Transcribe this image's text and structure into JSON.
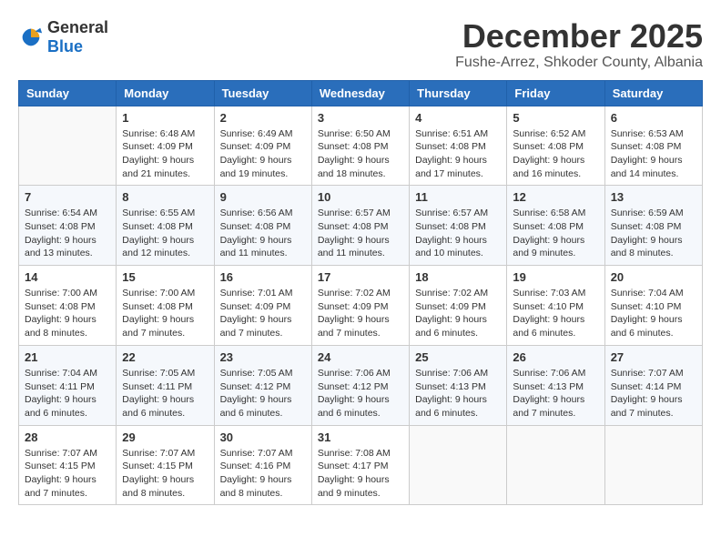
{
  "logo": {
    "general": "General",
    "blue": "Blue"
  },
  "title": {
    "month": "December 2025",
    "location": "Fushe-Arrez, Shkoder County, Albania"
  },
  "headers": [
    "Sunday",
    "Monday",
    "Tuesday",
    "Wednesday",
    "Thursday",
    "Friday",
    "Saturday"
  ],
  "weeks": [
    [
      {
        "day": "",
        "info": ""
      },
      {
        "day": "1",
        "info": "Sunrise: 6:48 AM\nSunset: 4:09 PM\nDaylight: 9 hours\nand 21 minutes."
      },
      {
        "day": "2",
        "info": "Sunrise: 6:49 AM\nSunset: 4:09 PM\nDaylight: 9 hours\nand 19 minutes."
      },
      {
        "day": "3",
        "info": "Sunrise: 6:50 AM\nSunset: 4:08 PM\nDaylight: 9 hours\nand 18 minutes."
      },
      {
        "day": "4",
        "info": "Sunrise: 6:51 AM\nSunset: 4:08 PM\nDaylight: 9 hours\nand 17 minutes."
      },
      {
        "day": "5",
        "info": "Sunrise: 6:52 AM\nSunset: 4:08 PM\nDaylight: 9 hours\nand 16 minutes."
      },
      {
        "day": "6",
        "info": "Sunrise: 6:53 AM\nSunset: 4:08 PM\nDaylight: 9 hours\nand 14 minutes."
      }
    ],
    [
      {
        "day": "7",
        "info": "Sunrise: 6:54 AM\nSunset: 4:08 PM\nDaylight: 9 hours\nand 13 minutes."
      },
      {
        "day": "8",
        "info": "Sunrise: 6:55 AM\nSunset: 4:08 PM\nDaylight: 9 hours\nand 12 minutes."
      },
      {
        "day": "9",
        "info": "Sunrise: 6:56 AM\nSunset: 4:08 PM\nDaylight: 9 hours\nand 11 minutes."
      },
      {
        "day": "10",
        "info": "Sunrise: 6:57 AM\nSunset: 4:08 PM\nDaylight: 9 hours\nand 11 minutes."
      },
      {
        "day": "11",
        "info": "Sunrise: 6:57 AM\nSunset: 4:08 PM\nDaylight: 9 hours\nand 10 minutes."
      },
      {
        "day": "12",
        "info": "Sunrise: 6:58 AM\nSunset: 4:08 PM\nDaylight: 9 hours\nand 9 minutes."
      },
      {
        "day": "13",
        "info": "Sunrise: 6:59 AM\nSunset: 4:08 PM\nDaylight: 9 hours\nand 8 minutes."
      }
    ],
    [
      {
        "day": "14",
        "info": "Sunrise: 7:00 AM\nSunset: 4:08 PM\nDaylight: 9 hours\nand 8 minutes."
      },
      {
        "day": "15",
        "info": "Sunrise: 7:00 AM\nSunset: 4:08 PM\nDaylight: 9 hours\nand 7 minutes."
      },
      {
        "day": "16",
        "info": "Sunrise: 7:01 AM\nSunset: 4:09 PM\nDaylight: 9 hours\nand 7 minutes."
      },
      {
        "day": "17",
        "info": "Sunrise: 7:02 AM\nSunset: 4:09 PM\nDaylight: 9 hours\nand 7 minutes."
      },
      {
        "day": "18",
        "info": "Sunrise: 7:02 AM\nSunset: 4:09 PM\nDaylight: 9 hours\nand 6 minutes."
      },
      {
        "day": "19",
        "info": "Sunrise: 7:03 AM\nSunset: 4:10 PM\nDaylight: 9 hours\nand 6 minutes."
      },
      {
        "day": "20",
        "info": "Sunrise: 7:04 AM\nSunset: 4:10 PM\nDaylight: 9 hours\nand 6 minutes."
      }
    ],
    [
      {
        "day": "21",
        "info": "Sunrise: 7:04 AM\nSunset: 4:11 PM\nDaylight: 9 hours\nand 6 minutes."
      },
      {
        "day": "22",
        "info": "Sunrise: 7:05 AM\nSunset: 4:11 PM\nDaylight: 9 hours\nand 6 minutes."
      },
      {
        "day": "23",
        "info": "Sunrise: 7:05 AM\nSunset: 4:12 PM\nDaylight: 9 hours\nand 6 minutes."
      },
      {
        "day": "24",
        "info": "Sunrise: 7:06 AM\nSunset: 4:12 PM\nDaylight: 9 hours\nand 6 minutes."
      },
      {
        "day": "25",
        "info": "Sunrise: 7:06 AM\nSunset: 4:13 PM\nDaylight: 9 hours\nand 6 minutes."
      },
      {
        "day": "26",
        "info": "Sunrise: 7:06 AM\nSunset: 4:13 PM\nDaylight: 9 hours\nand 7 minutes."
      },
      {
        "day": "27",
        "info": "Sunrise: 7:07 AM\nSunset: 4:14 PM\nDaylight: 9 hours\nand 7 minutes."
      }
    ],
    [
      {
        "day": "28",
        "info": "Sunrise: 7:07 AM\nSunset: 4:15 PM\nDaylight: 9 hours\nand 7 minutes."
      },
      {
        "day": "29",
        "info": "Sunrise: 7:07 AM\nSunset: 4:15 PM\nDaylight: 9 hours\nand 8 minutes."
      },
      {
        "day": "30",
        "info": "Sunrise: 7:07 AM\nSunset: 4:16 PM\nDaylight: 9 hours\nand 8 minutes."
      },
      {
        "day": "31",
        "info": "Sunrise: 7:08 AM\nSunset: 4:17 PM\nDaylight: 9 hours\nand 9 minutes."
      },
      {
        "day": "",
        "info": ""
      },
      {
        "day": "",
        "info": ""
      },
      {
        "day": "",
        "info": ""
      }
    ]
  ]
}
